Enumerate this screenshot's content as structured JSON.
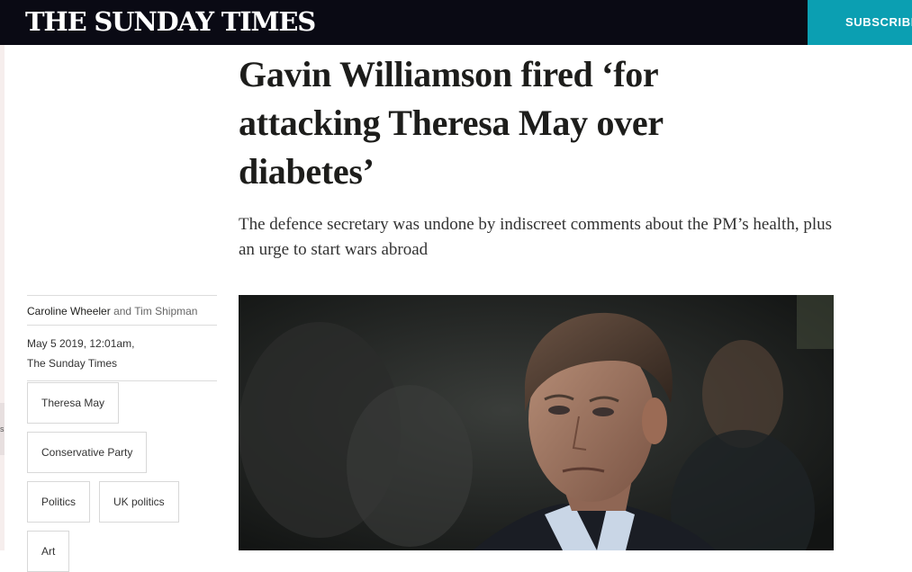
{
  "header": {
    "masthead": "THE SUNDAY TIMES",
    "subscribe_label": "SUBSCRIBE"
  },
  "article": {
    "headline": "Gavin Williamson fired ‘for attacking Theresa May over diabetes’",
    "standfirst": "The defence secretary was undone by indiscreet comments about the PM’s health, plus an urge to start wars abroad",
    "authors": [
      {
        "name": "Caroline Wheeler"
      },
      {
        "name": "Tim Shipman"
      }
    ],
    "author_conjunction": "and",
    "date": "May 5 2019, 12:01am,",
    "publication": "The Sunday Times",
    "tags": [
      {
        "label": "Theresa May"
      },
      {
        "label": "Conservative Party"
      },
      {
        "label": "Politics"
      },
      {
        "label": "UK politics"
      },
      {
        "label": "Art"
      }
    ]
  },
  "colors": {
    "topbar": "#0a0a14",
    "subscribe_bg": "#0b9fb2",
    "text": "#1d1d1b"
  },
  "icons": {
    "hero_image": "portrait-photo"
  }
}
